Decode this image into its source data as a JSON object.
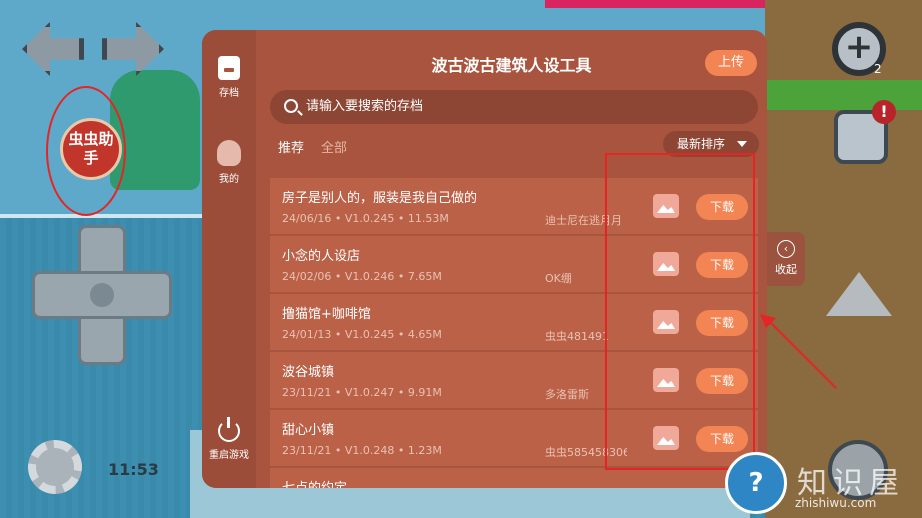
{
  "app": {
    "title": "波古波古建筑人设工具",
    "upload_label": "上传",
    "fold_label": "收起",
    "fold_icon": "‹"
  },
  "sidebar": {
    "items": [
      {
        "label": "存档",
        "icon": "save-icon"
      },
      {
        "label": "我的",
        "icon": "user-icon"
      },
      {
        "label": "重启游戏",
        "icon": "power-icon"
      }
    ]
  },
  "search": {
    "placeholder": "请输入要搜索的存档"
  },
  "tabs": [
    {
      "label": "推荐"
    },
    {
      "label": "全部"
    }
  ],
  "sort": {
    "label": "最新排序"
  },
  "download_label": "下载",
  "rows": [
    {
      "name": "房子是别人的，服装是我自己做的",
      "meta": "24/06/16 • V1.0.245 • 11.53M",
      "author": "迪士尼在逃月月"
    },
    {
      "name": "小念的人设店",
      "meta": "24/02/06 • V1.0.246 • 7.65M",
      "author": "OK绷"
    },
    {
      "name": "撸猫馆+咖啡馆",
      "meta": "24/01/13 • V1.0.245 • 4.65M",
      "author": "虫虫481491"
    },
    {
      "name": "波谷城镇",
      "meta": "23/11/21 • V1.0.247 • 9.91M",
      "author": "多洛雷斯"
    },
    {
      "name": "甜心小镇",
      "meta": "23/11/21 • V1.0.248 • 1.23M",
      "author": "虫虫585458306..."
    },
    {
      "name": "七点的约定",
      "meta": "",
      "author": ""
    }
  ],
  "game": {
    "helper_label": "虫虫助手",
    "clock": "11:53",
    "zoom_in_label": "+",
    "zoom_sub": "2",
    "alert": "!"
  },
  "watermark": {
    "text": "知识屋",
    "url": "zhishiwu.com",
    "badge": "?"
  },
  "colors": {
    "panel": "#a9543e",
    "row": "#bb6148",
    "accent": "#f28553",
    "annotation": "#e52525"
  }
}
